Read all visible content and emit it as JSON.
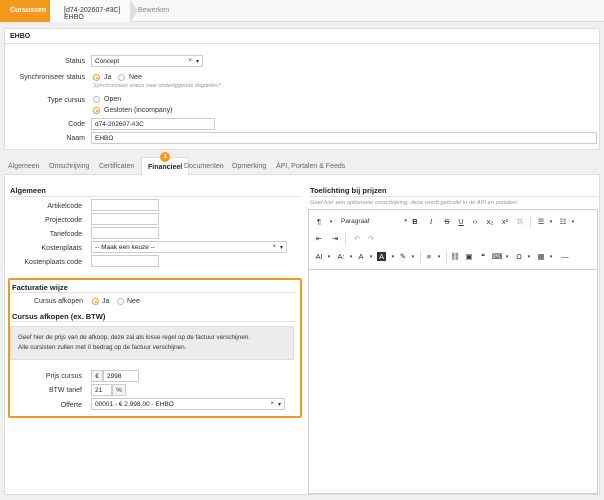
{
  "breadcrumb": {
    "item1": "Cursussen",
    "item2": "[d74-202607-#3C] EHBO",
    "item3": "Bewerken"
  },
  "top": {
    "title": "EHBO",
    "status_label": "Status",
    "status_value": "Concept",
    "sync_label": "Synchroniseer status",
    "sync_yes": "Ja",
    "sync_no": "Nee",
    "sync_hint": "Synchroniseer status naar onderliggende dagdelen?",
    "type_label": "Type cursus",
    "type_open": "Open",
    "type_closed": "Gesloten (incompany)",
    "code_label": "Code",
    "code_value": "d74-202607-#3C",
    "name_label": "Naam",
    "name_value": "EHBO"
  },
  "tabs": [
    {
      "label": "Algemeen"
    },
    {
      "label": "Omschrijving"
    },
    {
      "label": "Certificaten"
    },
    {
      "label": "Financieel",
      "badge": "1"
    },
    {
      "label": "Documenten"
    },
    {
      "label": "Opmerking"
    },
    {
      "label": "API, Portalen & Feeds"
    }
  ],
  "general": {
    "title": "Algemeen",
    "artikelcode_label": "Artikelcode",
    "projectcode_label": "Projectcode",
    "tariefcode_label": "Tariefcode",
    "kostenplaats_label": "Kostenplaats",
    "kostenplaats_value": "-- Maak een keuze --",
    "kostenplaats_code_label": "Kostenplaats code"
  },
  "facturatie": {
    "title": "Facturatie wijze",
    "afkopen_label": "Cursus afkopen",
    "yes": "Ja",
    "no": "Nee",
    "sub_title": "Cursus afkopen (ex. BTW)",
    "info_line1": "Geef hier de prijs van de afkoop, deze zal als losse regel op de factuur verschijnen.",
    "info_line2": "Alle cursisten zullen met 0 bedrag op de factuur verschijnen.",
    "prijs_label": "Prijs cursus",
    "prijs_prefix": "€",
    "prijs_value": "2998",
    "btw_label": "BTW tarief",
    "btw_value": "21",
    "btw_suffix": "%",
    "offerte_label": "Offerte",
    "offerte_value": "00001 - € 2.998,00 - EHBO"
  },
  "toelichting": {
    "title": "Toelichting bij prijzen",
    "hint": "Geef hier een optioneele omschrijving, deze wordt gebruikt in de API en portalen.",
    "paragraph": "Paragraaf"
  }
}
